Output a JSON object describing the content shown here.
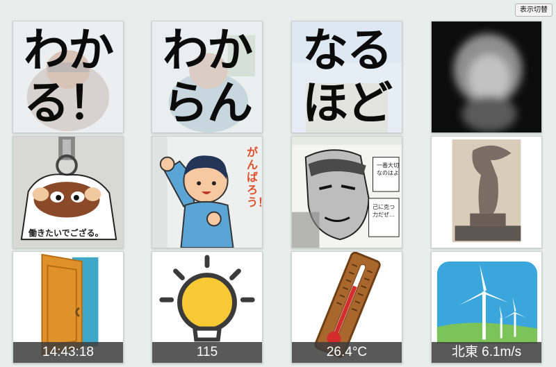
{
  "toolbar": {
    "toggle_label": "表示切替"
  },
  "tiles": {
    "row1": [
      {
        "lines": [
          "わか",
          "る！"
        ]
      },
      {
        "lines": [
          "わか",
          "らん"
        ]
      },
      {
        "lines": [
          "なる",
          "ほど"
        ]
      },
      {
        "name": "portrait"
      }
    ],
    "row2": [
      {
        "name": "mascot-keychain",
        "caption": "働きたいでござる。"
      },
      {
        "name": "ganbarou-illustration",
        "caption": "がんばろう！"
      },
      {
        "name": "manga-panel",
        "captions": [
          "一番大切なのはよ",
          "己に克つ力だぜ…"
        ]
      },
      {
        "name": "winged-victory-statue"
      }
    ],
    "row3": [
      {
        "name": "door",
        "value": "14:43:18"
      },
      {
        "name": "light-bulb",
        "value": "115"
      },
      {
        "name": "thermometer",
        "value": "26.4°C"
      },
      {
        "name": "wind-turbine",
        "value": "北東 6.1m/s"
      }
    ]
  },
  "colors": {
    "background": "#e7eeec",
    "door": "#e0922a",
    "bulb": "#f7c934",
    "thermo_wood": "#a9672d",
    "sky": "#3aa6dc"
  }
}
